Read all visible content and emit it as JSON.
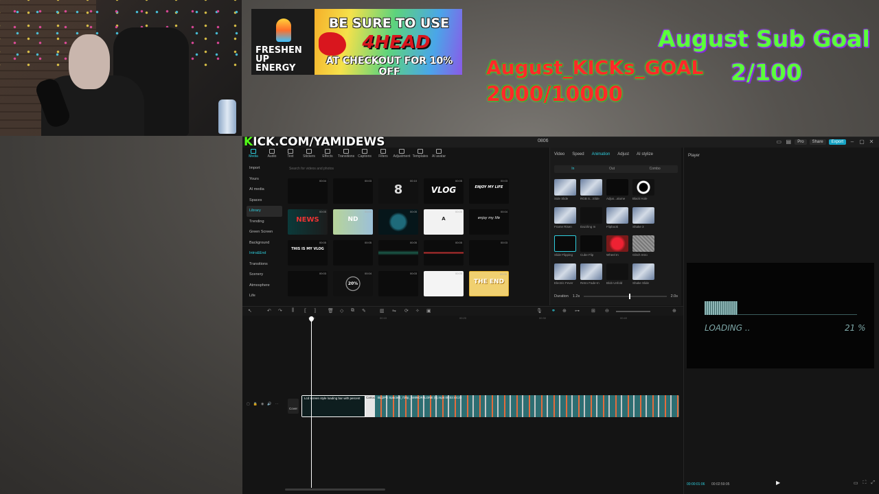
{
  "stream": {
    "kick_url": "KICK.COM/YAMIDEWS",
    "goals": {
      "kicks_title": "August_KICKs_GOAL",
      "kicks_count": "2000/10000",
      "sub_title": "August Sub Goal",
      "sub_count": "2/100"
    },
    "ad": {
      "brand": "FRESHEN UP\nENERGY",
      "line1": "BE SURE TO USE",
      "line2": "4HEAD",
      "line3": "AT CHECKOUT FOR 10% OFF"
    }
  },
  "editor": {
    "title": "0806",
    "titlebar_buttons": [
      "Pro",
      "Share",
      "Export"
    ],
    "media_tabs": [
      "Media",
      "Audio",
      "Text",
      "Stickers",
      "Effects",
      "Transitions",
      "Captions",
      "Filters",
      "Adjustment",
      "Templates",
      "AI avatar"
    ],
    "sidebar": [
      "Import",
      "Yours",
      "AI media",
      "Spaces",
      "Library",
      "Trending",
      "Green Screen",
      "Background",
      "Intro&End",
      "Transitions",
      "Scenery",
      "Atmosphere",
      "Life"
    ],
    "search_placeholder": "Search for videos and photos",
    "thumbnails": [
      {
        "caption": "",
        "duration": "00:04"
      },
      {
        "caption": "",
        "duration": "00:03"
      },
      {
        "caption": "8",
        "duration": "00:10"
      },
      {
        "caption": "VLOG",
        "duration": "00:05"
      },
      {
        "caption": "ENJOY MY LIFE",
        "duration": "00:03"
      },
      {
        "caption": "NEWS",
        "duration": "00:05"
      },
      {
        "caption": "ND",
        "duration": "00:05"
      },
      {
        "caption": "",
        "duration": "00:05"
      },
      {
        "caption": "A",
        "duration": "00:05"
      },
      {
        "caption": "enjoy my life",
        "duration": "00:04"
      },
      {
        "caption": "THIS IS MY VLOG",
        "duration": "00:05"
      },
      {
        "caption": "",
        "duration": "00:05"
      },
      {
        "caption": "",
        "duration": "00:05"
      },
      {
        "caption": "",
        "duration": "00:05"
      },
      {
        "caption": "",
        "duration": "00:03"
      },
      {
        "caption": "",
        "duration": "00:03"
      },
      {
        "caption": "20%",
        "duration": "00:04"
      },
      {
        "caption": "",
        "duration": "00:03"
      },
      {
        "caption": "",
        "duration": "00:05"
      },
      {
        "caption": "THE END",
        "duration": "00:05"
      }
    ],
    "animation": {
      "tabs": [
        "Video",
        "Speed",
        "Animation",
        "Adjust",
        "AI stylize"
      ],
      "subtabs": [
        "In",
        "Out",
        "Combo"
      ],
      "items": [
        "Side Slide",
        "RGB S...Slide",
        "Adjus...alume",
        "Black Hole",
        "Frame Risen",
        "Dazzling In",
        "Flipbook",
        "Shake 3",
        "Slide Flipping",
        "Cube Flip",
        "Wheel In",
        "Glitch Intro",
        "Electric Fever",
        "Retro Fade-In",
        "Blob Unfold",
        "Shake Slide"
      ],
      "duration_label": "Duration",
      "duration_min": "1.2s",
      "duration_max": "2.0s"
    },
    "player": {
      "title": "Player",
      "loading_label": "LOADING ..",
      "loading_percent": "21 %",
      "loading_progress": 0.21,
      "time_current": "00:00:01:06",
      "time_total": "00:02:59:05"
    },
    "timeline": {
      "ruler_marks": [
        "00:00",
        "00:10",
        "00:20",
        "00:30",
        "00:40"
      ],
      "clip_a_label": "Lcd screen style loading bar with percent",
      "clip_b_label": "Cartoo",
      "clip_c_label": "BL|2PE  Spacted_720p_AMINOFALONE (5).mp4  00:02:44:23",
      "cover_label": "Cover"
    }
  }
}
